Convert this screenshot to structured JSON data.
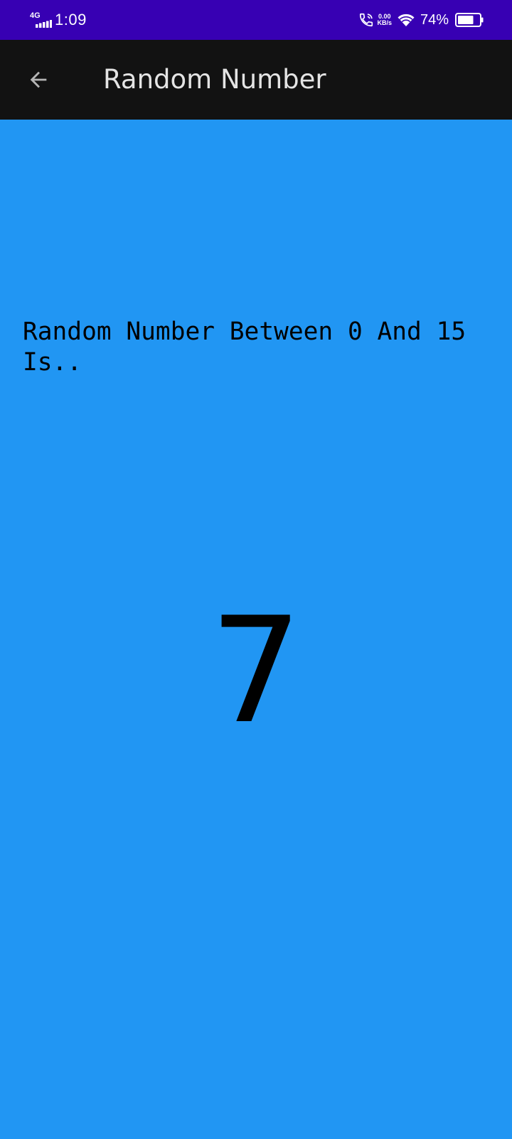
{
  "status_bar": {
    "network_type": "4G",
    "time": "1:09",
    "data_speed_value": "0.00",
    "data_speed_unit": "KB/s",
    "battery_percent": "74%",
    "battery_level": 0.74,
    "icons": [
      "signal-icon",
      "call-icon",
      "wifi-icon",
      "battery-icon"
    ],
    "background_color": "#3700b3"
  },
  "app_bar": {
    "title": "Random Number",
    "back_icon": "arrow-back-icon",
    "background_color": "#121212"
  },
  "main": {
    "prompt": "Random Number Between 0 And 15 Is..",
    "result": "7",
    "background_color": "#2196f3"
  }
}
